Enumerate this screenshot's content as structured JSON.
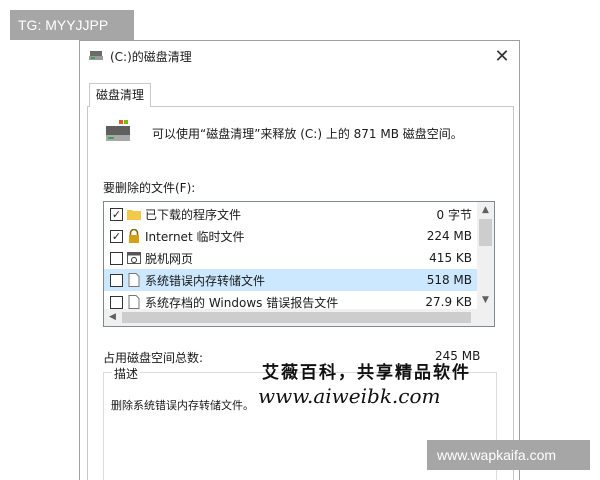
{
  "watermarks": {
    "top_left": "TG: MYYJJPP",
    "bottom_right": "www.wapkaifa.com",
    "cn_line": "艾薇百科，共享精品软件",
    "url_line": "www.aiweibk.com"
  },
  "window": {
    "title": "(C:)的磁盘清理",
    "close_glyph": "✕"
  },
  "tab": {
    "label": "磁盘清理"
  },
  "intro": "可以使用“磁盘清理”来释放 (C:) 上的 871 MB 磁盘空间。",
  "files_label": "要删除的文件(F):",
  "files": [
    {
      "name": "已下载的程序文件",
      "size": "0 字节",
      "checked": true,
      "icon": "folder-icon",
      "selected": false
    },
    {
      "name": "Internet 临时文件",
      "size": "224 MB",
      "checked": true,
      "icon": "lock-icon",
      "selected": false
    },
    {
      "name": "脱机网页",
      "size": "415 KB",
      "checked": false,
      "icon": "offline-page-icon",
      "selected": false
    },
    {
      "name": "系统错误内存转储文件",
      "size": "518 MB",
      "checked": false,
      "icon": "file-icon",
      "selected": true
    },
    {
      "name": "系统存档的 Windows 错误报告文件",
      "size": "27.9 KB",
      "checked": false,
      "icon": "file-icon",
      "selected": false
    }
  ],
  "total_label": "占用磁盘空间总数:",
  "total_value": "245 MB",
  "description": {
    "legend": "描述",
    "text": "删除系统错误内存转储文件。"
  },
  "colors": {
    "selection": "#cce8ff",
    "folder": "#f3c94b",
    "lock": "#d4a017"
  }
}
